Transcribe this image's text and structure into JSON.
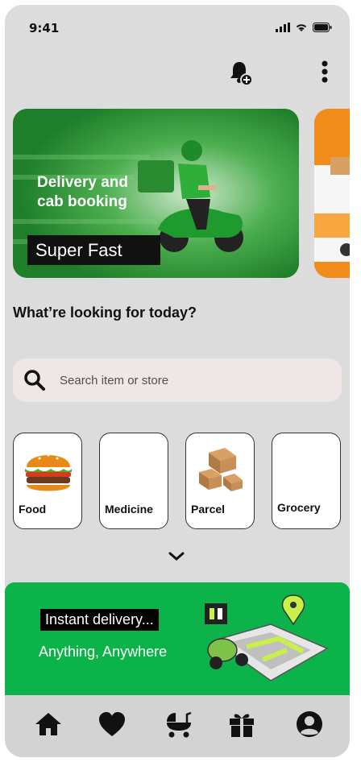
{
  "status_bar": {
    "time": "9:41"
  },
  "banners": [
    {
      "title": "Delivery and\ncab booking",
      "tag": "Super Fast"
    }
  ],
  "question": "What’re looking for today?",
  "search": {
    "placeholder": "Search item or store"
  },
  "categories": [
    {
      "label": "Food"
    },
    {
      "label": "Medicine"
    },
    {
      "label": "Parcel"
    },
    {
      "label": "Grocery"
    }
  ],
  "promo": {
    "tag": "Instant delivery...",
    "subtitle": "Anything, Anywhere"
  },
  "nav": [
    {
      "icon": "home-icon"
    },
    {
      "icon": "heart-icon"
    },
    {
      "icon": "stroller-icon"
    },
    {
      "icon": "gift-icon"
    },
    {
      "icon": "profile-icon"
    }
  ],
  "colors": {
    "primary_green": "#0bb34a",
    "banner_green": "#2f9e3a",
    "banner_orange": "#f28c1a",
    "background": "#dcdcdc"
  }
}
